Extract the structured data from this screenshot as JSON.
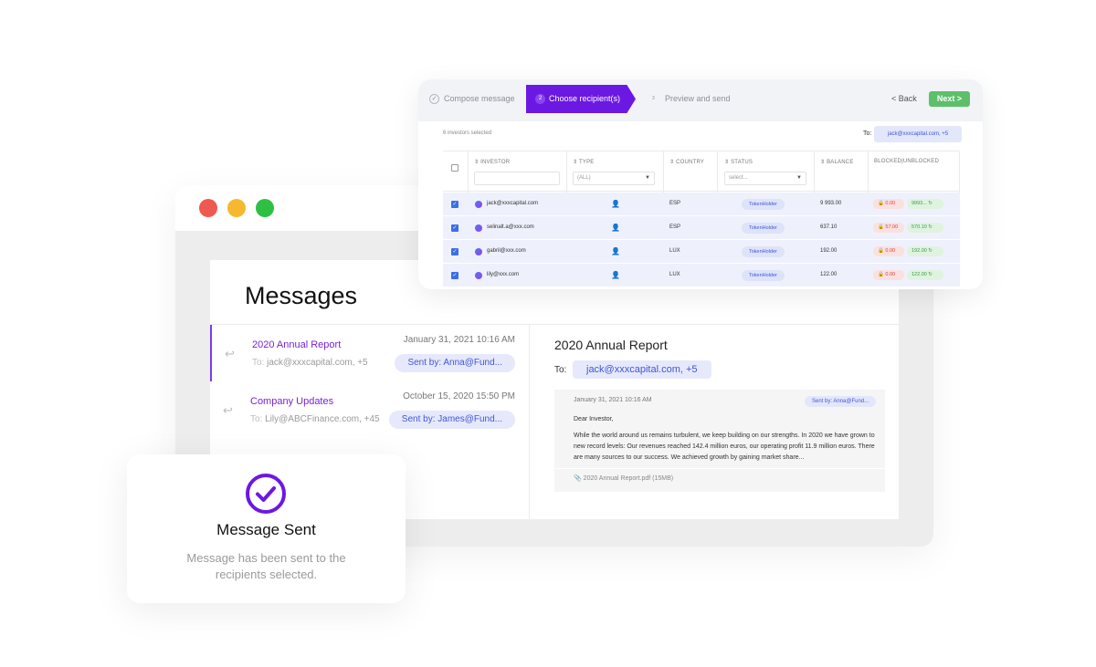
{
  "messages_window": {
    "title": "Messages",
    "list": [
      {
        "subject": "2020 Annual Report",
        "to_label": "To:",
        "to": "jack@xxxcapital.com, +5",
        "date": "January 31, 2021 10:16 AM",
        "sent_by": "Sent by: Anna@Fund..."
      },
      {
        "subject": "Company Updates",
        "to_label": "To:",
        "to": "Lily@ABCFinance.com, +45",
        "date": "October 15, 2020 15:50 PM",
        "sent_by": "Sent by: James@Fund..."
      }
    ],
    "detail": {
      "title": "2020 Annual Report",
      "to_label": "To:",
      "to_chip": "jack@xxxcapital.com, +5",
      "card_date": "January 31, 2021 10:16 AM",
      "card_sent_by": "Sent by: Anna@Fund...",
      "greeting": "Dear Investor,",
      "body": "While the world around us remains turbulent, we keep building on our strengths. In 2020 we have grown to new record levels: Our revenues reached 142.4 million euros, our operating profit 11.9 million euros. There are many sources to our success. We achieved growth by gaining market share...",
      "attachment": "2020 Annual Report.pdf (15MB)"
    }
  },
  "chooser": {
    "steps": {
      "step1": "Compose message",
      "step2_num": "2",
      "step2": "Choose recipient(s)",
      "step3_num": "3",
      "step3": "Preview and send"
    },
    "back": "< Back",
    "next": "Next >",
    "selected_count": "6 investors selected",
    "to_label": "To:",
    "to_chip": "jack@xxxcapital.com, +5",
    "columns": {
      "investor": "INVESTOR",
      "type": "TYPE",
      "type_filter": "(ALL)",
      "country": "COUNTRY",
      "status": "STATUS",
      "status_filter": "select...",
      "balance": "BALANCE",
      "blocked": "BLOCKED|UNBLOCKED"
    },
    "rows": [
      {
        "email": "jack@xxxcapital.com",
        "country": "ESP",
        "status": "TokenHolder",
        "balance": "9 993.00",
        "blocked": "0.00",
        "unblocked": "9993..."
      },
      {
        "email": "selinalt.a@xxx.com",
        "country": "ESP",
        "status": "TokenHolder",
        "balance": "637.10",
        "blocked": "57.00",
        "unblocked": "570.10"
      },
      {
        "email": "gabril@xxx.com",
        "country": "LUX",
        "status": "TokenHolder",
        "balance": "192.00",
        "blocked": "0.00",
        "unblocked": "192.00"
      },
      {
        "email": "lily@xxx.com",
        "country": "LUX",
        "status": "TokenHolder",
        "balance": "122.00",
        "blocked": "0.00",
        "unblocked": "122.00"
      }
    ]
  },
  "sent_card": {
    "title": "Message Sent",
    "description": "Message has been sent to the recipients selected."
  },
  "colors": {
    "accent": "#6c18e3",
    "chip_bg": "#e6e9fb",
    "chip_text": "#3f56d8",
    "next_green": "#5dbf6a"
  },
  "icons": [
    "reply-icon",
    "check-circle-icon",
    "paperclip-icon",
    "person-icon",
    "lock-icon",
    "unlock-icon",
    "sort-icon",
    "chevron-down-icon"
  ]
}
